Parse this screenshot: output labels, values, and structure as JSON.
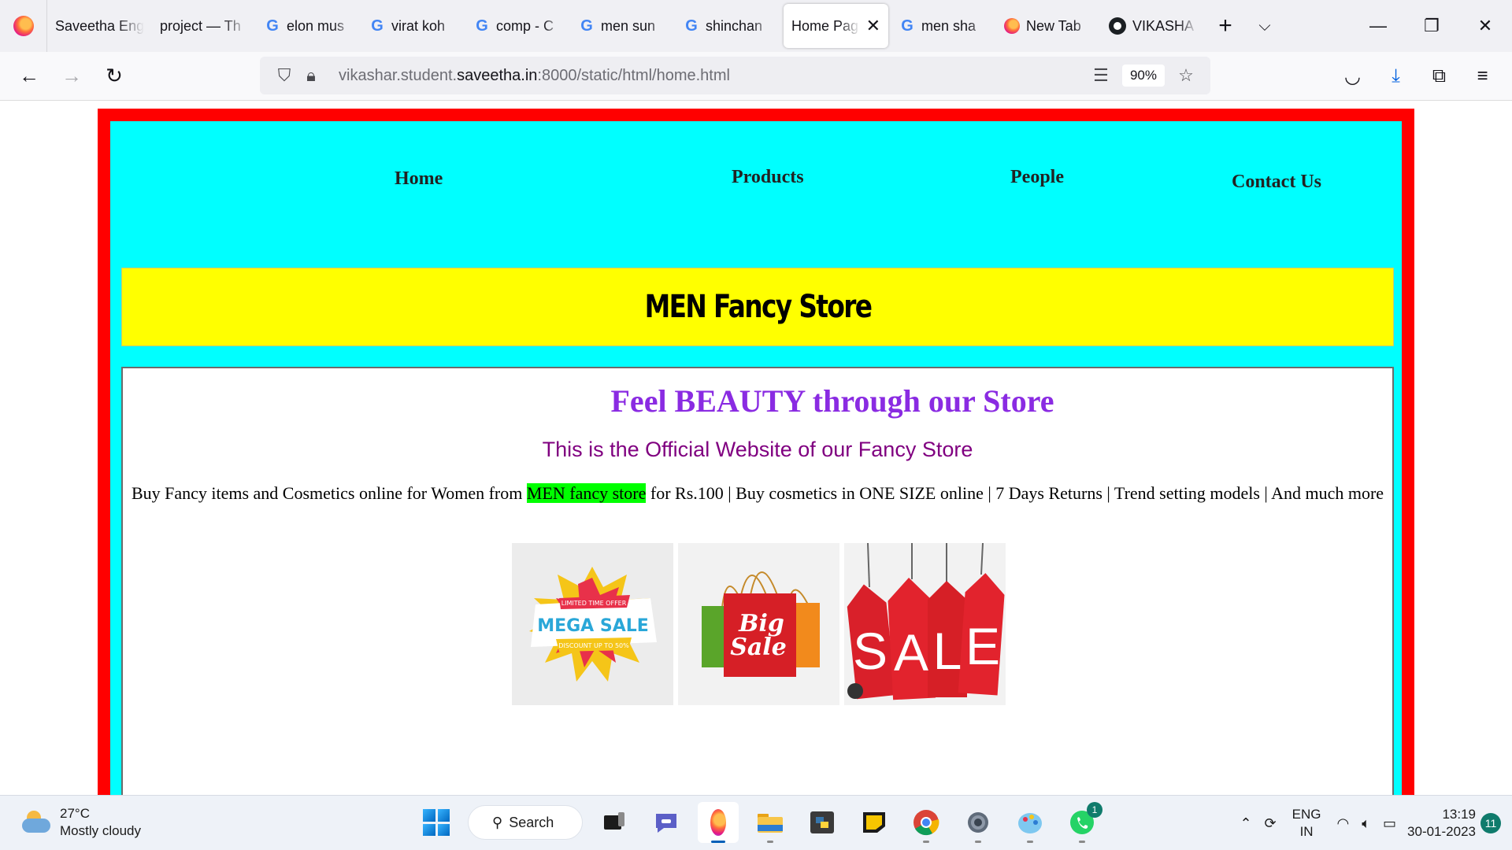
{
  "browser": {
    "tabs": [
      {
        "label": "Saveetha Eng",
        "icon": "none"
      },
      {
        "label": "project — Th",
        "icon": "none"
      },
      {
        "label": "elon mus",
        "icon": "google"
      },
      {
        "label": "virat koh",
        "icon": "google"
      },
      {
        "label": "comp - C",
        "icon": "google"
      },
      {
        "label": "men sun",
        "icon": "google"
      },
      {
        "label": "shinchan",
        "icon": "google"
      },
      {
        "label": "Home Pag",
        "icon": "none",
        "active": true
      },
      {
        "label": "men sha",
        "icon": "google"
      },
      {
        "label": "New Tab",
        "icon": "firefox"
      },
      {
        "label": "VIKASHA",
        "icon": "github"
      }
    ],
    "url_prefix": "vikashar.student.",
    "url_domain": "saveetha.in",
    "url_suffix": ":8000/static/html/home.html",
    "zoom": "90%"
  },
  "page": {
    "nav": {
      "home": "Home",
      "products": "Products",
      "people": "People",
      "contact": "Contact Us"
    },
    "store_title": "MEN Fancy Store",
    "tagline": "Feel BEAUTY through our Store",
    "subtitle": "This is the Official Website of our Fancy Store",
    "desc_before": "Buy Fancy items and Cosmetics online for Women from ",
    "desc_highlight": "MEN fancy store",
    "desc_after": " for Rs.100 | Buy cosmetics in ONE SIZE online | 7 Days Returns | Trend setting models | And much more",
    "images": {
      "mega_sale": {
        "top": "LIMITED TIME OFFER",
        "main": "MEGA SALE",
        "bottom": "DISCOUNT UP TO 50%"
      },
      "big_sale": {
        "line1": "Big",
        "line2": "Sale"
      },
      "sale_tags": [
        "S",
        "A",
        "L",
        "E"
      ]
    }
  },
  "taskbar": {
    "temp": "27°C",
    "weather": "Mostly cloudy",
    "search": "Search",
    "whatsapp_badge": "1",
    "lang_line1": "ENG",
    "lang_line2": "IN",
    "time": "13:19",
    "date": "30-01-2023",
    "notifications": "11"
  },
  "colors": {
    "frame": "#ff0000",
    "panel": "#00ffff",
    "banner": "#ffff00",
    "tagline": "#8a2be2",
    "subtitle": "#800080",
    "highlight": "#00ff00"
  }
}
